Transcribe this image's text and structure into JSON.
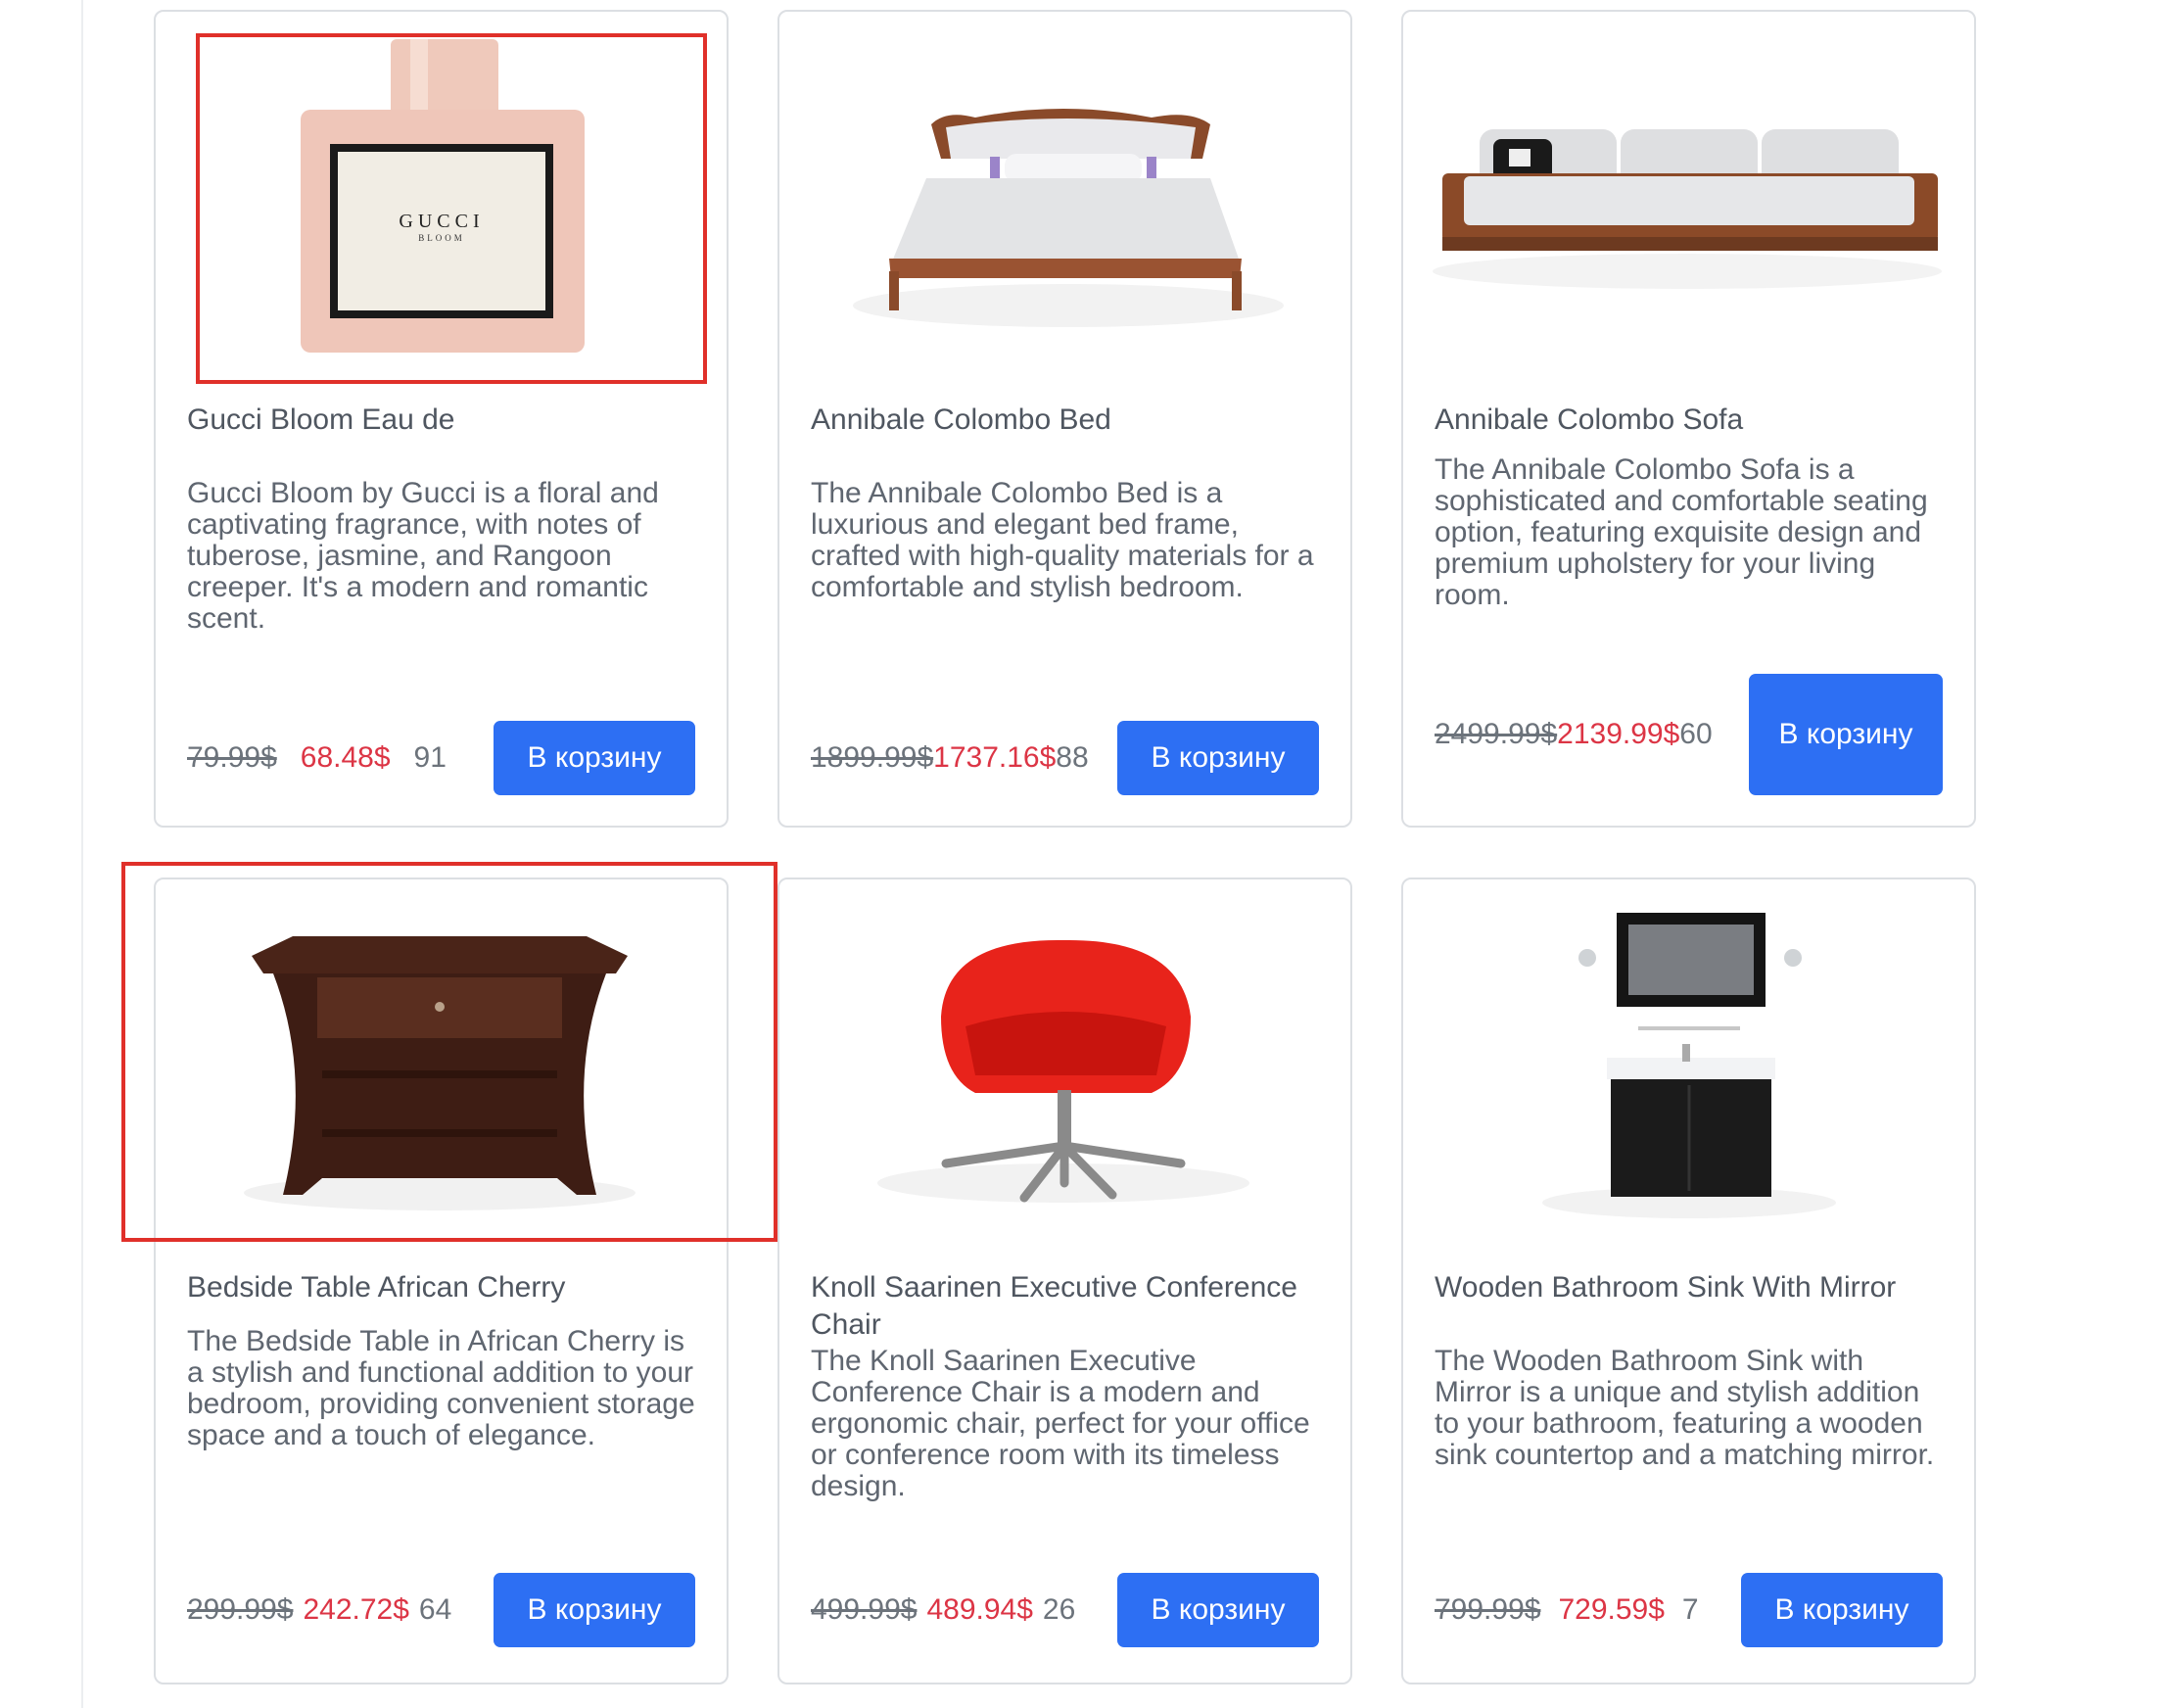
{
  "products": [
    {
      "title": "Gucci Bloom Eau de",
      "description": "Gucci Bloom by Gucci is a floral and captivating fragrance, with notes of tuberose, jasmine, and Rangoon creeper. It's a modern and romantic scent.",
      "old_price": "79.99$",
      "new_price": "68.48$",
      "stock": "91",
      "button": "В корзину",
      "brand_text": "GUCCI",
      "brand_sub": "BLOOM"
    },
    {
      "title": "Annibale Colombo Bed",
      "description": "The Annibale Colombo Bed is a luxurious and elegant bed frame, crafted with high-quality materials for a comfortable and stylish bedroom.",
      "old_price": "1899.99$",
      "new_price": "1737.16$",
      "stock": "88",
      "button": "В корзину"
    },
    {
      "title": "Annibale Colombo Sofa",
      "description": "The Annibale Colombo Sofa is a sophisticated and comfortable seating option, featuring exquisite design and premium upholstery for your living room.",
      "old_price": "2499.99$",
      "new_price": "2139.99$",
      "stock": "60",
      "button": "В корзину"
    },
    {
      "title": "Bedside Table African Cherry",
      "description": "The Bedside Table in African Cherry is a stylish and functional addition to your bedroom, providing convenient storage space and a touch of elegance.",
      "old_price": "299.99$",
      "new_price": "242.72$",
      "stock": "64",
      "button": "В корзину"
    },
    {
      "title": "Knoll Saarinen Executive Conference Chair",
      "description": "The Knoll Saarinen Executive Conference Chair is a modern and ergonomic chair, perfect for your office or conference room with its timeless design.",
      "old_price": "499.99$",
      "new_price": "489.94$",
      "stock": "26",
      "button": "В корзину"
    },
    {
      "title": "Wooden Bathroom Sink With Mirror",
      "description": "The Wooden Bathroom Sink with Mirror is a unique and stylish addition to your bathroom, featuring a wooden sink countertop and a matching mirror.",
      "old_price": "799.99$",
      "new_price": "729.59$",
      "stock": "7",
      "button": "В корзину"
    }
  ],
  "colors": {
    "button": "#2d6ff3",
    "new_price": "#dc3545",
    "highlight": "#e0302a"
  }
}
